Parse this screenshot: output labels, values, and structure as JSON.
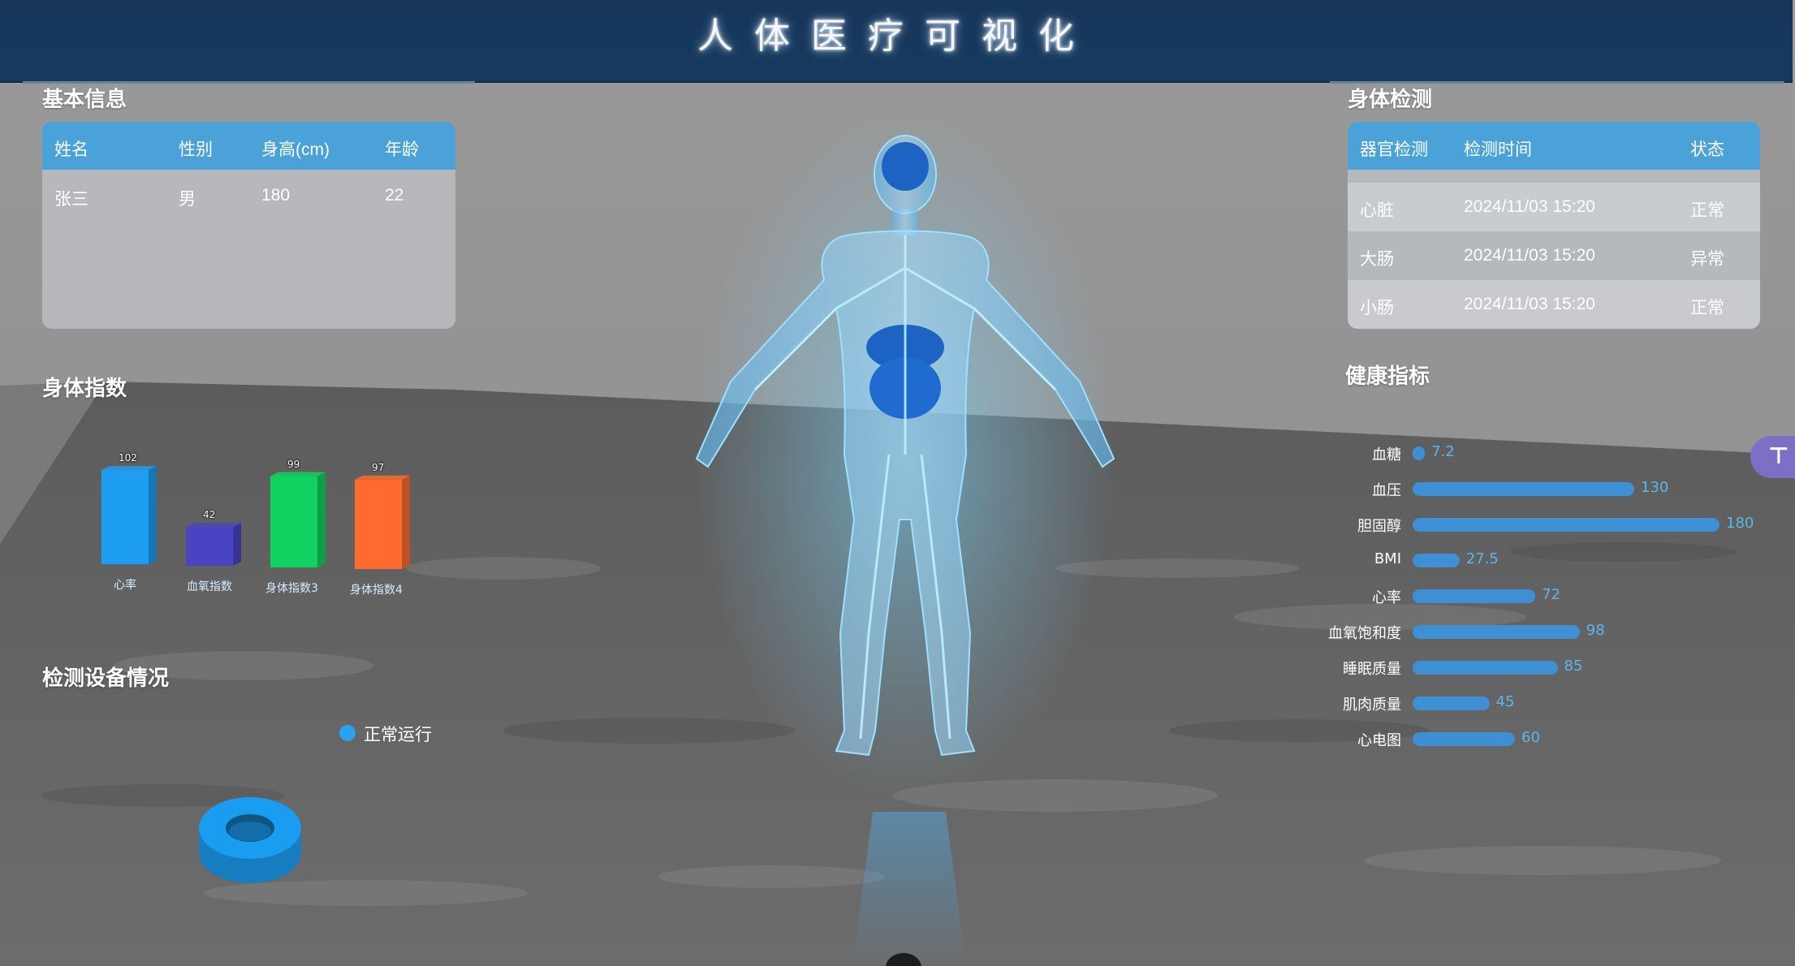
{
  "header": {
    "title": "人体医疗可视化"
  },
  "basic_info": {
    "title": "基本信息",
    "columns": [
      "姓名",
      "性别",
      "身高(cm)",
      "年龄"
    ],
    "row": [
      "张三",
      "男",
      "180",
      "22"
    ]
  },
  "body_index": {
    "title": "身体指数",
    "chart_data": {
      "type": "bar",
      "categories": [
        "心率",
        "血氧指数",
        "身体指数3",
        "身体指数4"
      ],
      "values": [
        102,
        42,
        99,
        97
      ],
      "colors": [
        "#1e9ef0",
        "#4b44c2",
        "#10d260",
        "#ff6a30"
      ]
    }
  },
  "device_status": {
    "title": "检测设备情况",
    "legend": "正常运行",
    "chart_data": {
      "type": "pie",
      "categories": [
        "正常运行"
      ],
      "values": [
        1
      ],
      "colors": [
        "#1a9cf0"
      ]
    }
  },
  "body_check": {
    "title": "身体检测",
    "columns": [
      "器官检测",
      "检测时间",
      "状态"
    ],
    "rows": [
      [
        "心脏",
        "2024/11/03 15:20",
        "正常"
      ],
      [
        "大肠",
        "2024/11/03 15:20",
        "异常"
      ],
      [
        "小肠",
        "2024/11/03 15:20",
        "正常"
      ]
    ]
  },
  "health": {
    "title": "健康指标",
    "chart_data": {
      "type": "bar",
      "orientation": "horizontal",
      "categories": [
        "血糖",
        "血压",
        "胆固醇",
        "BMI",
        "心率",
        "血氧饱和度",
        "睡眠质量",
        "肌肉质量",
        "心电图"
      ],
      "values": [
        7.2,
        130,
        180,
        27.5,
        72,
        98,
        85,
        45,
        60
      ],
      "labels": [
        "7.2",
        "130",
        "180",
        "27.5",
        "72",
        "98",
        "85",
        "45",
        "60"
      ],
      "xlim": [
        0,
        180
      ],
      "color": "#3f8fd4"
    }
  },
  "side_tab": {
    "icon": "filter-icon"
  }
}
